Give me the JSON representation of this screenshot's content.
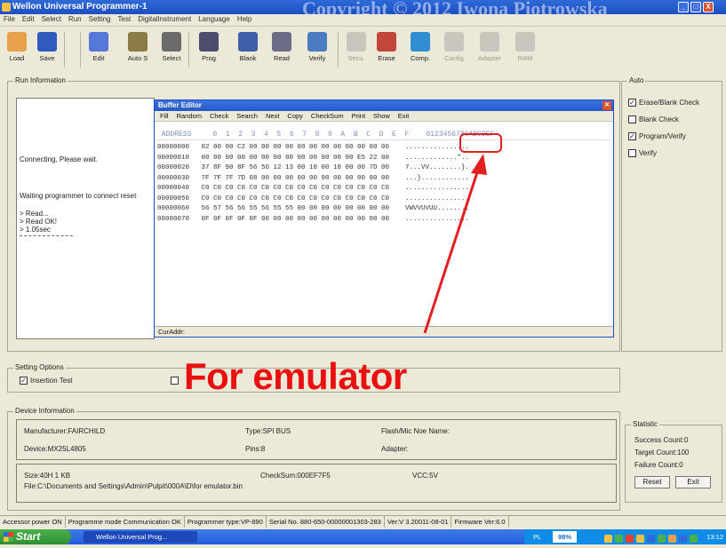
{
  "window": {
    "title": "Wellon Universal Programmer-1",
    "watermark": "Copyright © 2012 Iwona Piotrowska",
    "btn_min": "_",
    "btn_max": "□",
    "btn_close": "X"
  },
  "menu": [
    "File",
    "Edit",
    "Select",
    "Run",
    "Setting",
    "Test",
    "DigitalInstrument",
    "Language",
    "Help"
  ],
  "toolbar": [
    {
      "label": "Load",
      "color": "#e8a04a",
      "enabled": true
    },
    {
      "label": "Save",
      "color": "#2f5bbf",
      "enabled": true
    },
    {
      "label": "Edit",
      "color": "#5577d8",
      "enabled": true
    },
    {
      "label": "Auto S",
      "color": "#8d7b46",
      "enabled": true
    },
    {
      "label": "Select",
      "color": "#6b6b6b",
      "enabled": true
    },
    {
      "label": "Prog",
      "color": "#4c4c6c",
      "enabled": true
    },
    {
      "label": "Blank",
      "color": "#3c5fa8",
      "enabled": true
    },
    {
      "label": "Read",
      "color": "#6d6d88",
      "enabled": true
    },
    {
      "label": "Verify",
      "color": "#4b7bc0",
      "enabled": true
    },
    {
      "label": "Secu.",
      "color": "#999",
      "enabled": false
    },
    {
      "label": "Erase",
      "color": "#c0453a",
      "enabled": true
    },
    {
      "label": "Comp.",
      "color": "#2f8fd0",
      "enabled": true
    },
    {
      "label": "Config",
      "color": "#999",
      "enabled": false
    },
    {
      "label": "Adapter",
      "color": "#999",
      "enabled": false
    },
    {
      "label": "RAM",
      "color": "#999",
      "enabled": false
    }
  ],
  "run_panel": {
    "title": "Run Information",
    "lines": [
      "Connecting, Please wait.",
      "Waiting programmer to connect reset",
      "> Read...",
      "> Read OK!",
      "> 1.05sec"
    ]
  },
  "buffer_editor": {
    "title": "Buffer Editor",
    "menu": [
      "Fill",
      "Random",
      "Check",
      "Search",
      "Next",
      "Copy",
      "CheckSum",
      "Print",
      "Show",
      "Exit"
    ],
    "header": " ADDRESS     0  1  2  3  4  5  6  7  8  9  A  B  C  D  E  F    0123456789ABCDEF",
    "rows": [
      "00000000   02 00 00 C2 00 00 00 00 00 00 00 00 00 00 00 00    ................",
      "00000010   00 00 00 00 00 00 00 00 00 00 00 00 00 E5 22 00    .............\"..",
      "00000020   37 8F 90 8F 56 56 12 13 00 10 00 10 00 00 7D 00    7...VV........}.",
      "00000030   7F 7F 7F 7D 08 00 00 00 00 00 00 00 00 00 00 00    ...}............",
      "00000040   C0 C0 C0 C0 C0 C0 C0 C0 C0 C0 C0 C0 C0 C0 C0 C0    ................",
      "00000050   C0 C0 C0 C0 C0 C0 C0 C0 C0 C0 C0 C0 C0 C0 C0 C0    ................",
      "00000060   56 57 56 56 55 56 55 55 00 00 00 00 00 00 00 00    VWVVUVUU........",
      "00000070   0F 0F 0F 0F 0F 00 00 00 00 00 00 00 00 00 00 00    ................"
    ],
    "status": "CurAddr:"
  },
  "auto": {
    "title": "Auto",
    "options": [
      {
        "label": "Erase/Blank Check",
        "checked": true
      },
      {
        "label": "Blank Check",
        "checked": false
      },
      {
        "label": "Program/Verify",
        "checked": true
      },
      {
        "label": "Verify",
        "checked": false
      }
    ]
  },
  "setting": {
    "title": "Setting Options",
    "options": [
      {
        "label": "Insertion Test",
        "checked": true
      },
      {
        "label": "",
        "checked": false
      }
    ]
  },
  "annotation": "For emulator",
  "device": {
    "title": "Device Information",
    "manufacturer": "Manufacturer:FAIRCHILD",
    "type": "Type:SPI BUS",
    "flash": "Flash/Mic Noe Name:",
    "device": "Device:MX25L4805",
    "pins": "Pins:8",
    "adapter": "Adapter:",
    "size": "Size:40H 1 KB",
    "checksum": "CheckSum:000EF7F5",
    "vcc": "VCC:5V",
    "file": "File:C:\\Documents and Settings\\Admin\\Pulpit\\000A\\D\\for emulator.bin"
  },
  "statistic": {
    "title": "Statistic",
    "success": "Success Count:0",
    "target": "Target Count:100",
    "failure": "Failure Count:0",
    "reset": "Reset",
    "exit": "Exit"
  },
  "statusbar": [
    "Accessor power ON",
    "Programme mode Communication OK",
    "Programmer type:VP-890",
    "Serial No. 880-650-00000001303-283",
    "Ver:V 3.20011-08-01",
    "Firmware Ver:6.0"
  ],
  "taskbar": {
    "start": "Start",
    "task": "Wellon Universal Prog...",
    "lang": "PL",
    "battery": "98%",
    "clock": "13:12"
  },
  "colors": {
    "title_blue": "#1c4fc3",
    "annotation_red": "#ea1010",
    "highlight_red": "#e32020"
  }
}
